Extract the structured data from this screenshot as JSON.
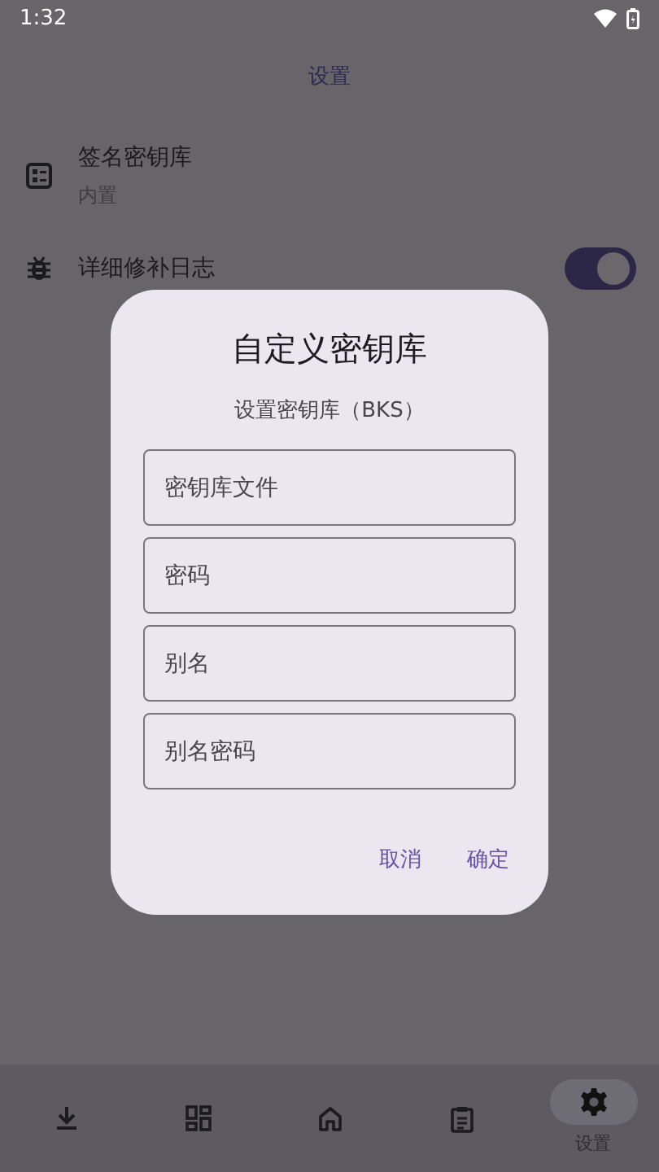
{
  "status_bar": {
    "time": "1:32"
  },
  "app_bar": {
    "title": "设置"
  },
  "settings": [
    {
      "kind": "value",
      "title": "签名密钥库",
      "summary": "内置"
    },
    {
      "kind": "switch",
      "title": "详细修补日志",
      "on": true
    }
  ],
  "dialog": {
    "title": "自定义密钥库",
    "subtitle": "设置密钥库（BKS）",
    "fields": [
      {
        "placeholder": "密钥库文件"
      },
      {
        "placeholder": "密码"
      },
      {
        "placeholder": "别名"
      },
      {
        "placeholder": "别名密码"
      }
    ],
    "buttons": [
      "取消",
      "确定"
    ]
  },
  "bottom_nav": [
    {
      "selected": false
    },
    {
      "selected": false
    },
    {
      "selected": false
    },
    {
      "selected": false
    },
    {
      "label": "设置",
      "selected": true
    }
  ]
}
